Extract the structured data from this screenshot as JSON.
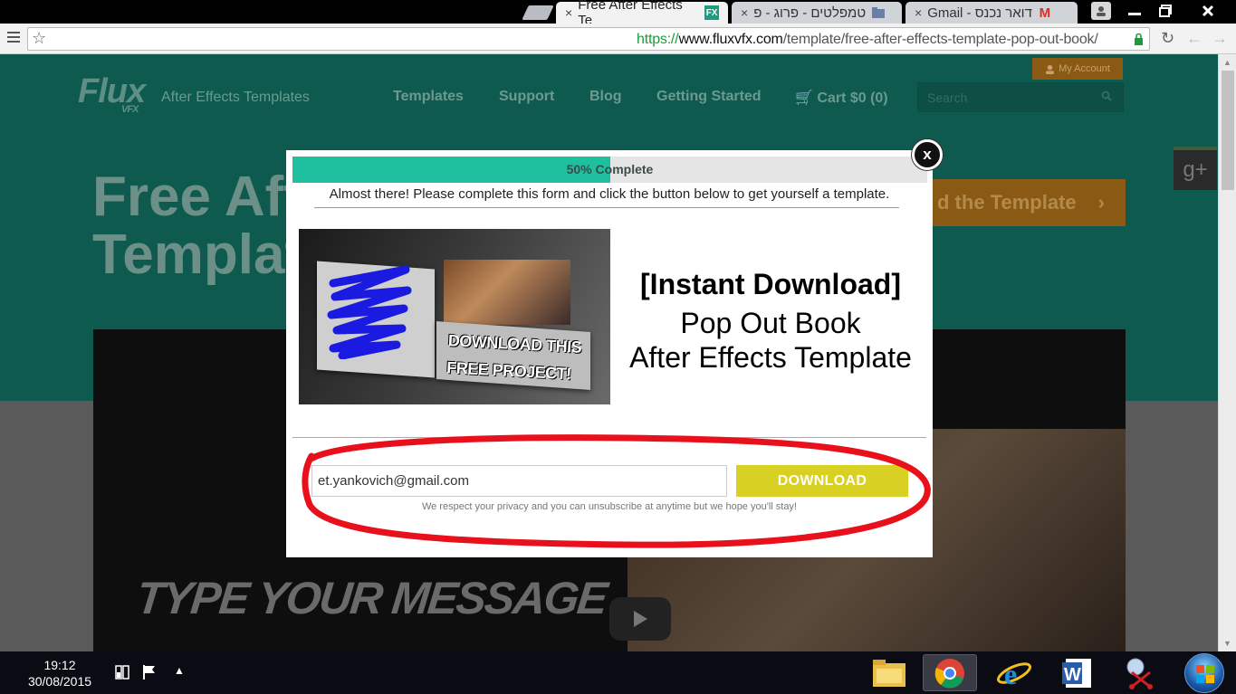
{
  "browser": {
    "tabs": [
      {
        "title": "Free After Effects Te",
        "favicon": "FX",
        "active": true
      },
      {
        "title": "טמפלטים - פרוג - פ",
        "favicon": "folder-icon",
        "active": false
      },
      {
        "title": "דואר נכנס - Gmail",
        "favicon": "M",
        "active": false
      }
    ],
    "url": {
      "scheme": "https://",
      "host": "www.fluxvfx.com",
      "path": "/template/free-after-effects-template-pop-out-book/"
    }
  },
  "site": {
    "logo": "Flux",
    "logo_sub": "VFX",
    "tagline": "After Effects Templates",
    "nav": [
      "Templates",
      "Support",
      "Blog",
      "Getting Started",
      "Cart $0 (0)"
    ],
    "account_label": "My Account",
    "search_placeholder": "Search",
    "gplus_label": "g+",
    "headline_line1": "Free Aft",
    "headline_line2": "Templat",
    "get_button": "d the Template",
    "video_overlay_text": "TYPE YOUR MESSAGE"
  },
  "modal": {
    "progress_label": "50% Complete",
    "progress_percent": 50,
    "subtitle": "Almost there! Please complete this form and click the button below to get yourself a template.",
    "image_cta_line1": "DOWNLOAD THIS",
    "image_cta_line2": "FREE PROJECT!",
    "title_line1": "[Instant Download]",
    "title_line2": "Pop Out Book",
    "title_line3": "After Effects Template",
    "email_value": "et.yankovich@gmail.com",
    "download_label": "DOWNLOAD",
    "privacy_text": "We respect your privacy and you can unsubscribe at anytime but we hope you'll stay!",
    "close_label": "x"
  },
  "taskbar": {
    "time": "19:12",
    "date": "30/08/2015"
  },
  "colors": {
    "teal_bg": "#0f5a4e",
    "progress_fill": "#1ec0a0",
    "download_button": "#d9d024",
    "annotation_red": "#e8101a"
  }
}
